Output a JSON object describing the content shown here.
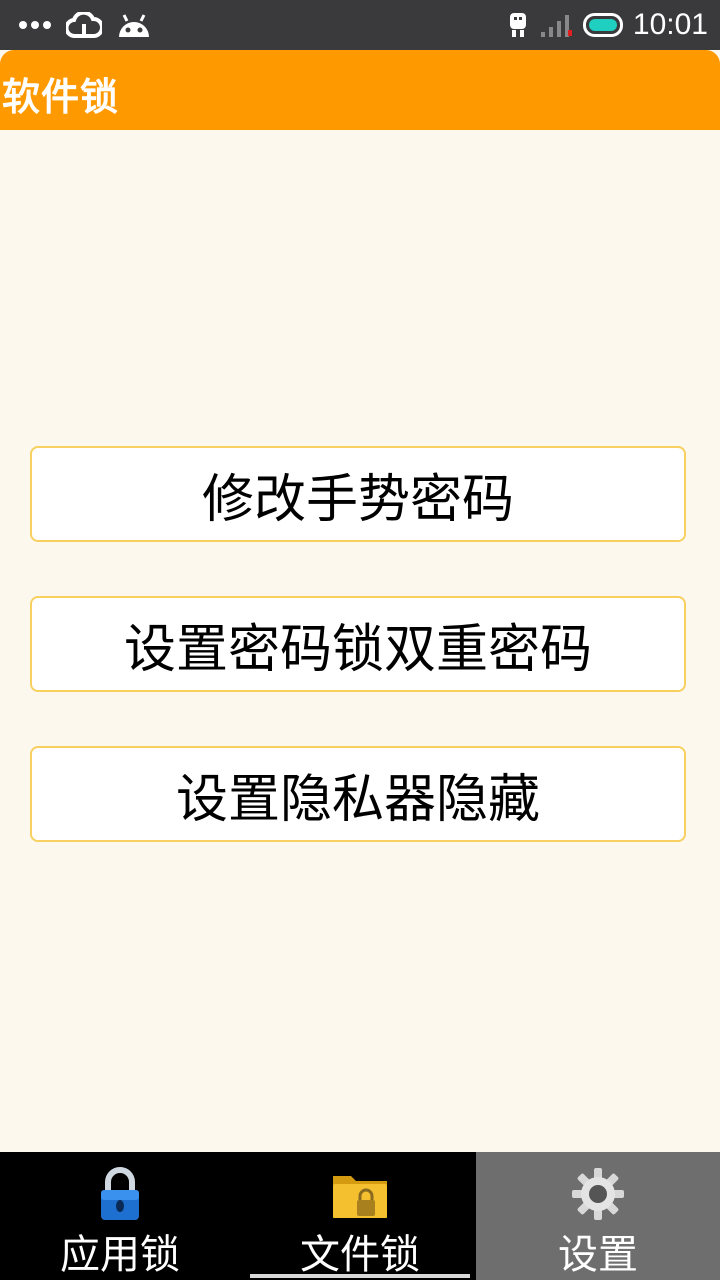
{
  "status_bar": {
    "time": "10:01",
    "left_icons": [
      "more-dots-icon",
      "cloud-icon",
      "android-icon"
    ],
    "right_icons": [
      "usb-debug-icon",
      "signal-icon",
      "battery-icon"
    ]
  },
  "header": {
    "title": "软件锁",
    "color": "#fe9900"
  },
  "menu": {
    "items": [
      {
        "label": "修改手势密码"
      },
      {
        "label": "设置密码锁双重密码"
      },
      {
        "label": "设置隐私器隐藏"
      }
    ]
  },
  "bottom_nav": {
    "tabs": [
      {
        "label": "应用锁",
        "icon": "padlock-icon",
        "selected": false
      },
      {
        "label": "文件锁",
        "icon": "folder-lock-icon",
        "selected": false
      },
      {
        "label": "设置",
        "icon": "gear-icon",
        "selected": true
      }
    ]
  },
  "colors": {
    "background": "#fcf8ee",
    "button_border": "#f8d060",
    "selected_tab": "#6e6e6e"
  }
}
